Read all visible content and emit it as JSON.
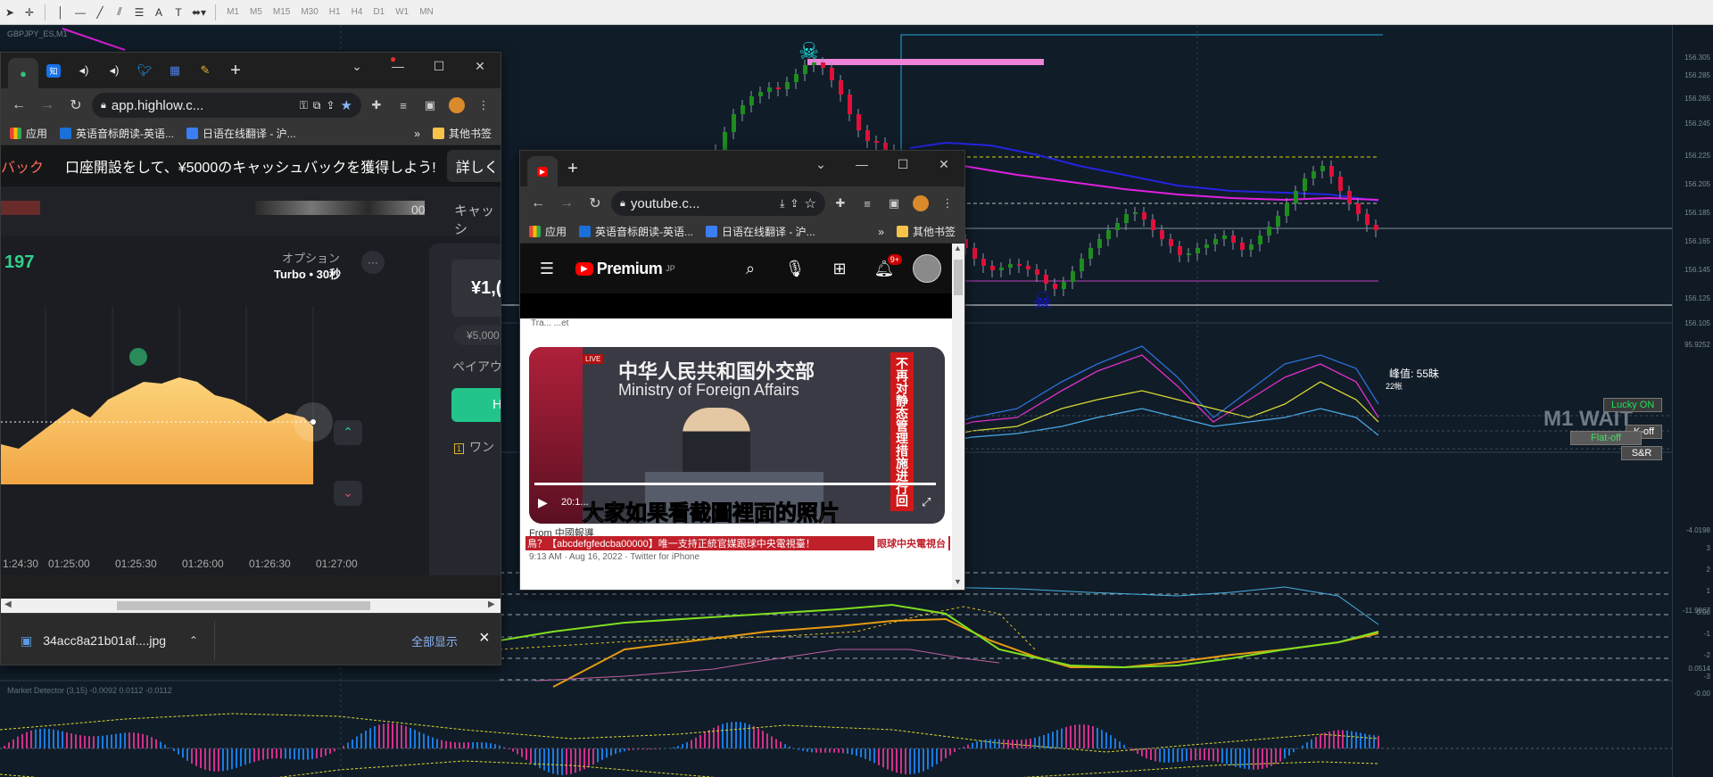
{
  "mt": {
    "symbol": "GBPJPY_ES,M1",
    "timeframes": [
      "M1",
      "M5",
      "M15",
      "M30",
      "H1",
      "H4",
      "D1",
      "W1",
      "MN"
    ],
    "price_ticks": [
      "156.305",
      "156.285",
      "156.265",
      "156.245",
      "156.225",
      "156.205",
      "156.185",
      "156.165",
      "156.145",
      "156.125",
      "156.105",
      "95.9252",
      "-4.0198",
      "-11.9867",
      "0.0514",
      "-0.00"
    ],
    "annotation_main": "峰值: 55昧",
    "annotation_sub": "22帐",
    "m1_wait": "M1 WAIT",
    "lucky_on": "Lucky ON",
    "flat_off": "Flat-off",
    "k_off": "K-off",
    "sr": "S&R",
    "indicator_label": "Market Detector (3,15) -0.0092 0.0112 -0.0112",
    "osc_levels": [
      "3",
      "2",
      "1",
      "0.00",
      "-1",
      "-2",
      "-3"
    ],
    "colors": {
      "bull": "#1e8c1e",
      "bear": "#e0103a",
      "ma_blue": "#2a2adf",
      "ma_magenta": "#e020e0"
    }
  },
  "highlow": {
    "tabs": [
      "highlow-icon",
      "zhihu-icon",
      "audio-icon",
      "audio-icon",
      "twitter-icon",
      "app-icon",
      "pencil-icon"
    ],
    "new_tab": "+",
    "url": "app.highlow.c...",
    "bookmarks": [
      "应用",
      "英语音标朗读-英语...",
      "日语在线翻译 - 沪..."
    ],
    "more_bookmarks": "»",
    "other_bookmarks": "其他书签",
    "banner_prefix": "バック",
    "banner_text": "口座開設をして、¥5000のキャッシュバックを獲得しよう!",
    "banner_btn": "詳しく",
    "tab_right": "キャッシ",
    "balance_hint": "00",
    "price": "197",
    "option_label": "オプション",
    "option_value": "Turbo • 30秒",
    "more": "···",
    "amount": "¥1,(",
    "amount_sub": "¥5,000",
    "payout_label": "ペイアウ",
    "high_btn": "H",
    "one_click": "ワン",
    "time_ticks": [
      "1:24:30",
      "01:25:00",
      "01:25:30",
      "01:26:00",
      "01:26:30",
      "01:27:00"
    ],
    "download_name": "34acc8a21b01af....jpg",
    "show_all": "全部显示",
    "close": "×"
  },
  "youtube": {
    "tab_new": "+",
    "url": "youtube.c...",
    "bookmarks": [
      "应用",
      "英语音标朗读-英语...",
      "日语在线翻译 - 沪..."
    ],
    "more_bookmarks": "»",
    "other_bookmarks": "其他书签",
    "logo_text": "Premium",
    "region": "JP",
    "notif_count": "9+",
    "video_banner_cn": "中华人民共和国外交部",
    "video_banner_en": "Ministry of Foreign Affairs",
    "live_badge": "LIVE",
    "caption": "大家如果看截圖裡面的照片",
    "side_text": "不再对静态管理措施进行回应",
    "from_label": "From 中國報導",
    "ticker": "鳥？【abcdefgfedcba00000】唯一支持正統官媒跟球中央電視臺！",
    "channel_tag": "眼球中央電視台",
    "time_line": "9:13 AM · Aug 16, 2022 · Twitter for iPhone",
    "overlay_time": "20:1...",
    "top_text": "Tra... ...et"
  }
}
